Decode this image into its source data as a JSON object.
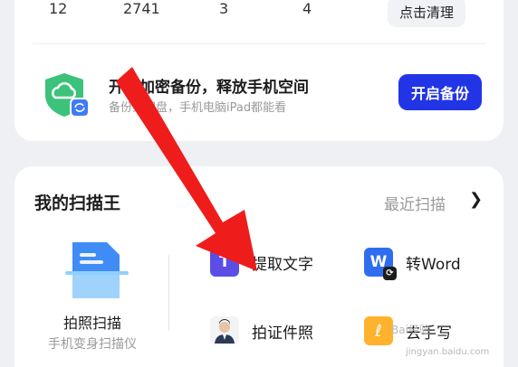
{
  "stats": {
    "values": [
      "12",
      "2741",
      "3",
      "4"
    ],
    "clean_label": "点击清理"
  },
  "backup": {
    "title": "开启加密备份，释放手机空间",
    "subtitle": "备份到网盘，手机电脑iPad都能看",
    "button_label": "开启备份"
  },
  "scan": {
    "title": "我的扫描王",
    "recent_label": "最近扫描",
    "recent_arrow": "❯",
    "photo_scan": {
      "label": "拍照扫描",
      "sub": "手机变身扫描仪"
    },
    "features": [
      {
        "label": "提取文字",
        "icon": "text-extract-icon",
        "glyph": "T"
      },
      {
        "label": "转Word",
        "icon": "word-convert-icon",
        "glyph": "W"
      },
      {
        "label": "拍证件照",
        "icon": "id-photo-icon",
        "glyph": ""
      },
      {
        "label": "去手写",
        "icon": "remove-handwriting-icon",
        "glyph": "ℓ"
      }
    ]
  },
  "watermark": {
    "text": "Bai经验",
    "sub": "jingyan.baidu.com"
  },
  "colors": {
    "accent": "#2235e6",
    "arrow": "#ef1c1c"
  }
}
